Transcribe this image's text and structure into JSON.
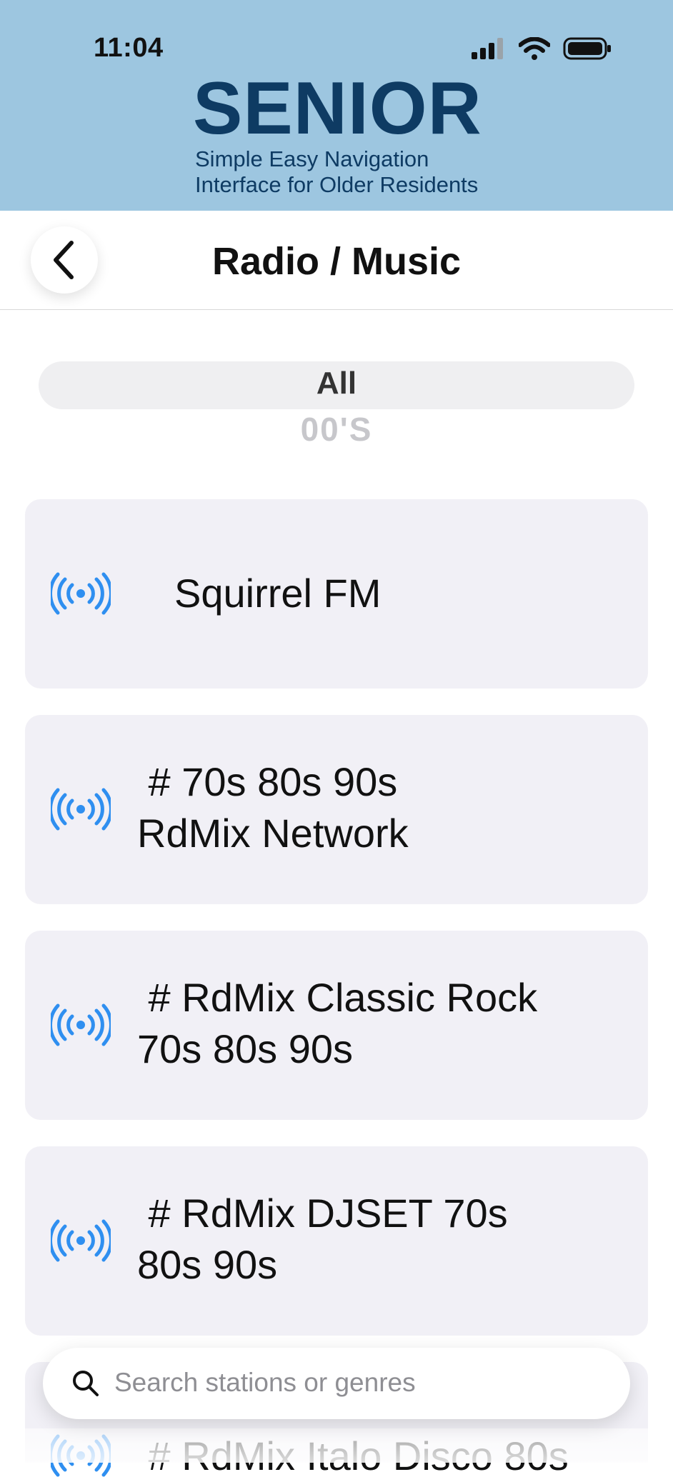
{
  "status_bar": {
    "time": "11:04"
  },
  "brand": {
    "title": "SENIOR",
    "subtitle_line1": "Simple Easy Navigation",
    "subtitle_line2": "Interface for Older Residents"
  },
  "nav": {
    "title": "Radio / Music"
  },
  "genre_picker": {
    "selected": "All",
    "next": "00'S"
  },
  "stations": [
    {
      "line1": "Squirrel FM",
      "line2": ""
    },
    {
      "line1": " # 70s 80s 90s",
      "line2": "RdMix Network"
    },
    {
      "line1": " # RdMix Classic Rock",
      "line2": "70s 80s 90s"
    },
    {
      "line1": " # RdMix DJSET 70s",
      "line2": "80s 90s"
    },
    {
      "line1": " # RdMix Italo Disco 80s",
      "line2": ""
    }
  ],
  "search": {
    "placeholder": "Search stations or genres"
  },
  "icons": {
    "station": "broadcast-icon",
    "back": "chevron-left-icon",
    "search": "search-icon"
  },
  "colors": {
    "header_bg": "#9dc6e0",
    "brand": "#0e3b63",
    "accent": "#2f8ff0",
    "card_bg": "#f1f0f6"
  }
}
